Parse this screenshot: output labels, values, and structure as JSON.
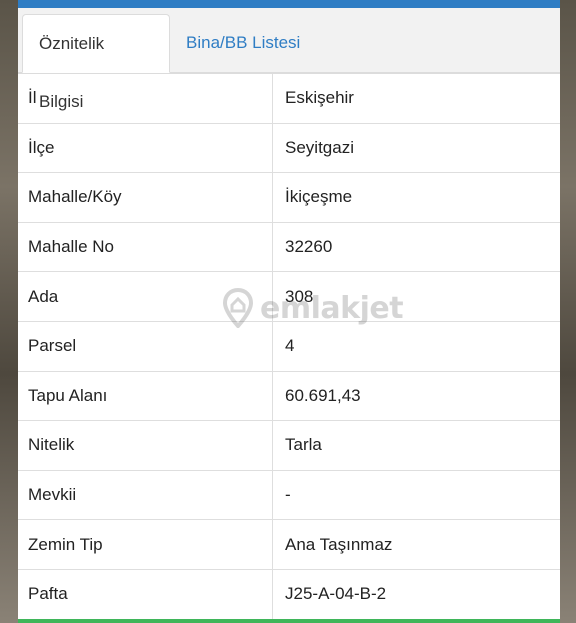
{
  "tabs": [
    {
      "label": "Öznitelik Bilgisi",
      "active": true
    },
    {
      "label": "Bina/BB Listesi",
      "active": false
    }
  ],
  "rows": [
    {
      "key": "İl",
      "value": "Eskişehir"
    },
    {
      "key": "İlçe",
      "value": "Seyitgazi"
    },
    {
      "key": "Mahalle/Köy",
      "value": "İkiçeşme"
    },
    {
      "key": "Mahalle No",
      "value": "32260"
    },
    {
      "key": "Ada",
      "value": "308"
    },
    {
      "key": "Parsel",
      "value": "4"
    },
    {
      "key": "Tapu Alanı",
      "value": "60.691,43"
    },
    {
      "key": "Nitelik",
      "value": "Tarla"
    },
    {
      "key": "Mevkii",
      "value": "-"
    },
    {
      "key": "Zemin Tip",
      "value": "Ana Taşınmaz"
    },
    {
      "key": "Pafta",
      "value": "J25-A-04-B-2"
    }
  ],
  "watermark": {
    "text": "emlakjet",
    "icon": "location-pin-icon"
  },
  "colors": {
    "accent": "#2f7dc4",
    "bottom_bar": "#3fb65a"
  }
}
